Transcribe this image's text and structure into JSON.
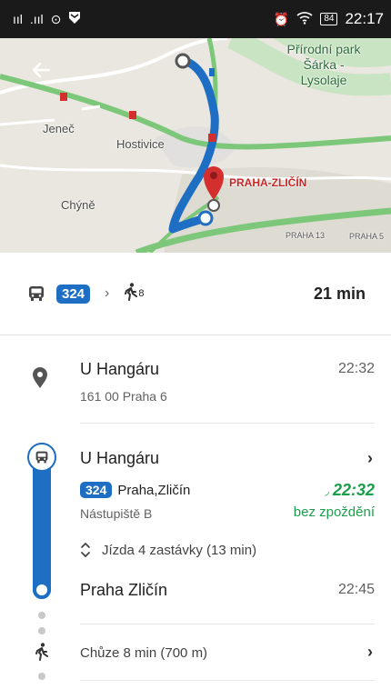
{
  "status_bar": {
    "signal_1": "ııl",
    "signal_2": ".ııl",
    "clock": "22:17",
    "battery": "84"
  },
  "map": {
    "labels": {
      "park": "Přírodní park Šárka - Lysolaje",
      "jenec": "Jeneč",
      "hostivice": "Hostivice",
      "chyne": "Chýně",
      "destination": "PRAHA-ZLIČÍN",
      "praha13": "PRAHA 13",
      "praha5": "PRAHA 5"
    }
  },
  "summary": {
    "line": "324",
    "walk_minutes": "8",
    "duration": "21 min"
  },
  "origin": {
    "name": "U Hangáru",
    "address": "161 00 Praha 6",
    "time": "22:32"
  },
  "transit": {
    "stop_name": "U Hangáru",
    "line": "324",
    "direction": "Praha,Zličín",
    "platform": "Nástupiště B",
    "realtime_time": "22:32",
    "status": "bez zpoždění",
    "ride_info": "Jízda 4 zastávky (13 min)",
    "arrival_stop": "Praha Zličín",
    "arrival_time": "22:45"
  },
  "walk": {
    "label": "Chůze 8 min (700 m)"
  },
  "colors": {
    "transit_blue": "#1e6fc3",
    "on_time_green": "#1b9e4b",
    "destination_red": "#d32f2f"
  }
}
